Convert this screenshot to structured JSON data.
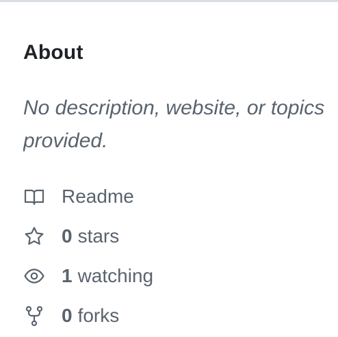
{
  "about": {
    "title": "About",
    "description": "No description, website, or topics provided."
  },
  "meta": {
    "readme": {
      "label": "Readme",
      "icon": "book-icon"
    },
    "stars": {
      "count": "0",
      "label": "stars",
      "icon": "star-icon"
    },
    "watching": {
      "count": "1",
      "label": "watching",
      "icon": "eye-icon"
    },
    "forks": {
      "count": "0",
      "label": "forks",
      "icon": "fork-icon"
    }
  },
  "colors": {
    "heading": "#1f2328",
    "muted": "#59636e",
    "divider": "#d8dee4"
  }
}
